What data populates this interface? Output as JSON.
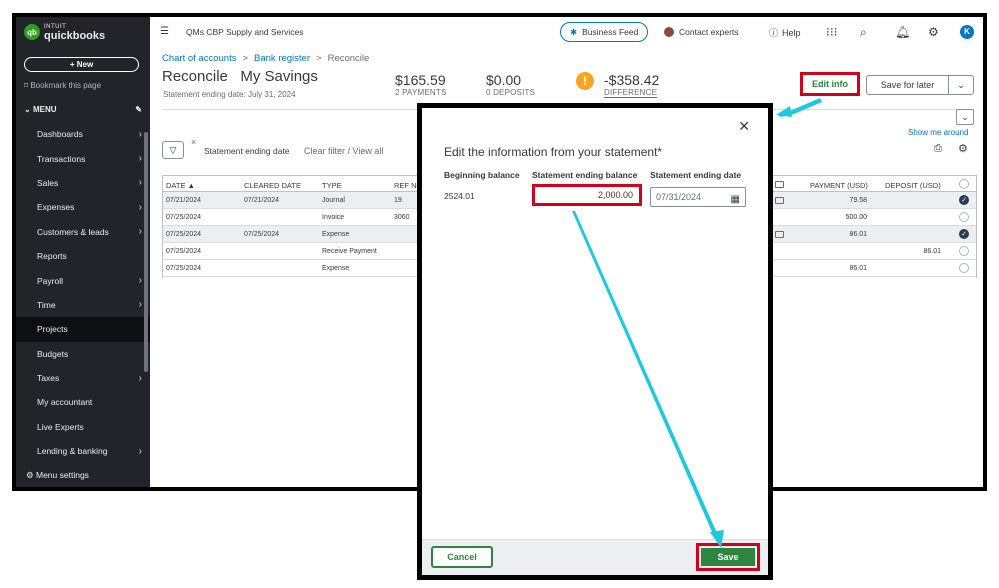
{
  "sidebar": {
    "brand_top": "INTUIT",
    "brand_name": "quickbooks",
    "new_label": "+ New",
    "bookmark_label": "Bookmark this page",
    "menu_label": "MENU",
    "items": [
      {
        "label": "Dashboards",
        "chevron": true
      },
      {
        "label": "Transactions",
        "chevron": true
      },
      {
        "label": "Sales",
        "chevron": true
      },
      {
        "label": "Expenses",
        "chevron": true
      },
      {
        "label": "Customers & leads",
        "chevron": true
      },
      {
        "label": "Reports",
        "chevron": false
      },
      {
        "label": "Payroll",
        "chevron": true
      },
      {
        "label": "Time",
        "chevron": true
      },
      {
        "label": "Projects",
        "chevron": false
      },
      {
        "label": "Budgets",
        "chevron": false
      },
      {
        "label": "Taxes",
        "chevron": true
      },
      {
        "label": "My accountant",
        "chevron": false
      },
      {
        "label": "Live Experts",
        "chevron": false
      },
      {
        "label": "Lending & banking",
        "chevron": true
      }
    ],
    "menu_settings_label": "Menu settings"
  },
  "topbar": {
    "company": "QMs CBP Supply and Services",
    "business_feed": "Business Feed",
    "contact_experts": "Contact experts",
    "help": "Help",
    "user_initial": "K"
  },
  "page": {
    "breadcrumb": [
      "Chart of accounts",
      "Bank register",
      "Reconcile"
    ],
    "title": "Reconcile   My Savings",
    "subtitle": "Statement ending date: July 31, 2024",
    "payments_amount": "$165.59",
    "payments_label": "2 PAYMENTS",
    "deposits_amount": "$0.00",
    "deposits_label": "0 DEPOSITS",
    "difference_amount": "-$358.42",
    "difference_label": "DIFFERENCE",
    "edit_info": "Edit info",
    "save_for_later": "Save for later",
    "filter_label": "Statement ending date",
    "clear_filter": "Clear filter / View all",
    "show_me_around": "Show me around"
  },
  "table": {
    "headers": {
      "date": "DATE ▲",
      "cleared": "CLEARED DATE",
      "type": "TYPE",
      "ref": "REF NO",
      "payment": "PAYMENT (USD)",
      "deposit": "DEPOSIT (USD)"
    },
    "rows": [
      {
        "date": "07/21/2024",
        "cleared": "07/21/2024",
        "type": "Journal",
        "ref": "19",
        "payment": "79.58",
        "deposit": "",
        "checked": true,
        "alt": true,
        "icon": true
      },
      {
        "date": "07/25/2024",
        "cleared": "",
        "type": "Invoice",
        "ref": "3060",
        "payment": "500.00",
        "deposit": "",
        "checked": false,
        "alt": false,
        "icon": false
      },
      {
        "date": "07/25/2024",
        "cleared": "07/25/2024",
        "type": "Expense",
        "ref": "",
        "payment": "86.01",
        "deposit": "",
        "checked": true,
        "alt": true,
        "icon": true
      },
      {
        "date": "07/25/2024",
        "cleared": "",
        "type": "Receive Payment",
        "ref": "",
        "payment": "",
        "deposit": "86.01",
        "checked": false,
        "alt": false,
        "icon": false
      },
      {
        "date": "07/25/2024",
        "cleared": "",
        "type": "Expense",
        "ref": "",
        "payment": "86.01",
        "deposit": "",
        "checked": false,
        "alt": false,
        "icon": false
      }
    ]
  },
  "modal": {
    "title": "Edit the information from your statement*",
    "beginning_label": "Beginning balance",
    "beginning_value": "2524.01",
    "ending_balance_label": "Statement ending balance",
    "ending_balance_value": "2,000.00",
    "ending_date_label": "Statement ending date",
    "ending_date_value": "07/31/2024",
    "cancel": "Cancel",
    "save": "Save"
  },
  "colors": {
    "accent_green": "#2e8540",
    "highlight_red": "#d0021b",
    "arrow_cyan": "#1ec8e0",
    "link_blue": "#0077c5",
    "sidebar_bg": "#212529"
  }
}
